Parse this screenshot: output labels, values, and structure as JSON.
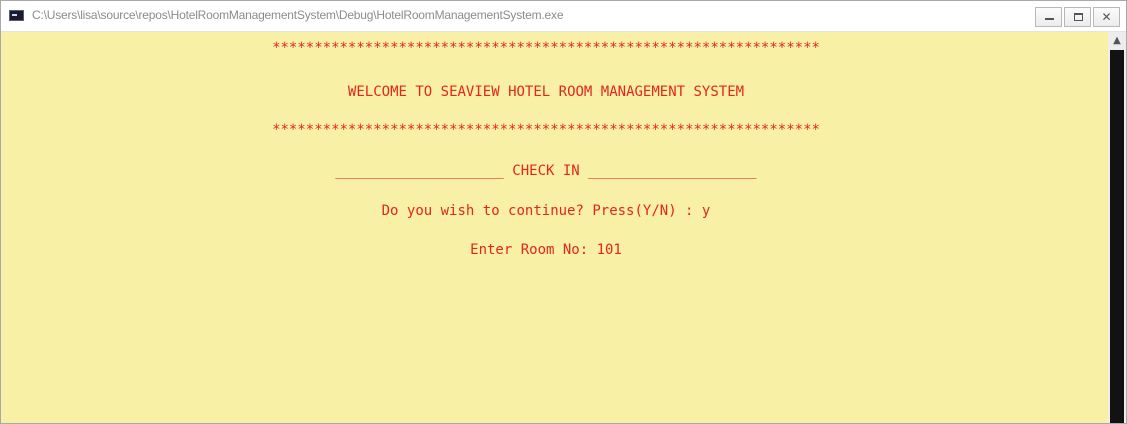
{
  "window": {
    "title": "C:\\Users\\lisa\\source\\repos\\HotelRoomManagementSystem\\Debug\\HotelRoomManagementSystem.exe",
    "controls": {
      "minimize": "–",
      "maximize": "□",
      "close": "✕"
    }
  },
  "console": {
    "stars_top": "*****************************************************************",
    "welcome": "WELCOME TO SEAVIEW HOTEL ROOM MANAGEMENT SYSTEM",
    "stars_bottom": "*****************************************************************",
    "section_header": "____________________ CHECK IN ____________________",
    "continue_prompt": "Do you wish to continue? Press(Y/N) : y",
    "room_prompt": "Enter Room No: 101"
  },
  "colors": {
    "console_background": "#f8f0a4",
    "console_text": "#e32620",
    "scrollbar_thumb": "#121212"
  }
}
